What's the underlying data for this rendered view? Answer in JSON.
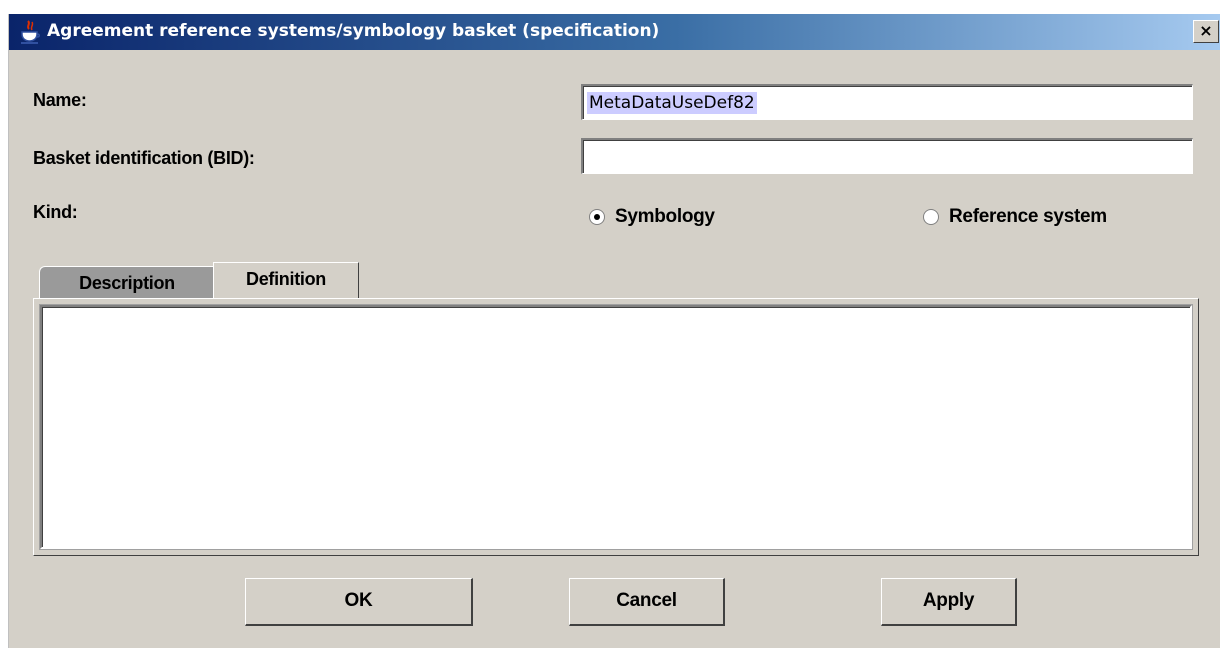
{
  "window": {
    "title": "Agreement reference systems/symbology basket (specification)",
    "close_glyph": "×",
    "app_icon": "java-cup-icon"
  },
  "form": {
    "name_label": "Name:",
    "name_value": "MetaDataUseDef82",
    "bid_label": "Basket identification (BID):",
    "bid_value": "",
    "kind_label": "Kind:",
    "kind_options": [
      {
        "label": "Symbology",
        "selected": true
      },
      {
        "label": "Reference system",
        "selected": false
      }
    ]
  },
  "tabs": [
    {
      "label": "Description",
      "active": false
    },
    {
      "label": "Definition",
      "active": true
    }
  ],
  "definition_text": "",
  "buttons": {
    "ok": "OK",
    "cancel": "Cancel",
    "apply": "Apply"
  },
  "colors": {
    "title_gradient_start": "#0a246a",
    "title_gradient_end": "#a6caf0",
    "dialog_bg": "#d4d0c8",
    "selection": "#ccccff"
  }
}
